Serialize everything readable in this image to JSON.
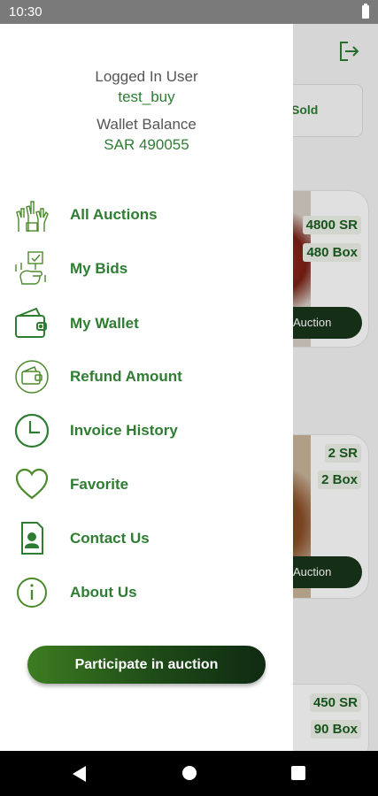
{
  "status_bar": {
    "time": "10:30"
  },
  "background": {
    "sold_label": "Sold",
    "cards": [
      {
        "price": "4800 SR",
        "quantity": "480 Box",
        "button": "Auction"
      },
      {
        "price": "2 SR",
        "quantity": "2 Box",
        "button": "Auction"
      },
      {
        "price": "450 SR",
        "quantity": "90 Box"
      }
    ]
  },
  "drawer": {
    "user_label": "Logged In User",
    "user_name": "test_buy",
    "wallet_label": "Wallet Balance",
    "wallet_value": "SAR 490055",
    "menu": [
      {
        "label": "All Auctions",
        "icon": "hands-raised-icon"
      },
      {
        "label": "My Bids",
        "icon": "bid-hand-icon"
      },
      {
        "label": "My Wallet",
        "icon": "wallet-icon"
      },
      {
        "label": "Refund Amount",
        "icon": "refund-wallet-icon"
      },
      {
        "label": "Invoice History",
        "icon": "clock-icon"
      },
      {
        "label": "Favorite",
        "icon": "heart-icon"
      },
      {
        "label": "Contact Us",
        "icon": "contact-card-icon"
      },
      {
        "label": "About Us",
        "icon": "info-icon"
      }
    ],
    "participate_button": "Participate in auction"
  },
  "colors": {
    "accent": "#2e7d32",
    "button_dark": "#17361a"
  }
}
